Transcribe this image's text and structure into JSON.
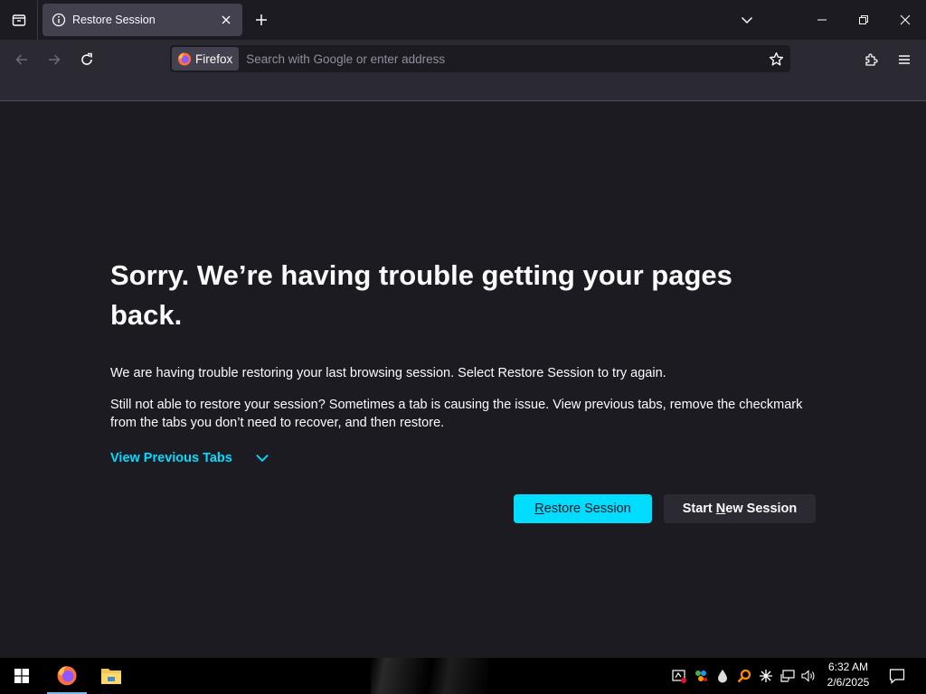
{
  "tab": {
    "title": "Restore Session"
  },
  "urlbar": {
    "identity_label": "Firefox",
    "placeholder": "Search with Google or enter address"
  },
  "content": {
    "heading": "Sorry. We’re having trouble getting your pages back.",
    "paragraph1": "We are having trouble restoring your last browsing session. Select Restore Session to try again.",
    "paragraph2": "Still not able to restore your session? Sometimes a tab is causing the issue. View previous tabs, remove the checkmark from the tabs you don’t need to recover, and then restore.",
    "view_previous_tabs": "View Previous Tabs",
    "restore_button": {
      "accesskey": "R",
      "rest": "estore Session"
    },
    "new_session_button": {
      "before": "Start ",
      "accesskey": "N",
      "rest": "ew Session"
    }
  },
  "taskbar": {
    "time": "6:32 AM",
    "date": "2/6/2025"
  },
  "colors": {
    "accent": "#00ddff",
    "background": "#1c1b22",
    "toolbar": "#2b2a33"
  }
}
